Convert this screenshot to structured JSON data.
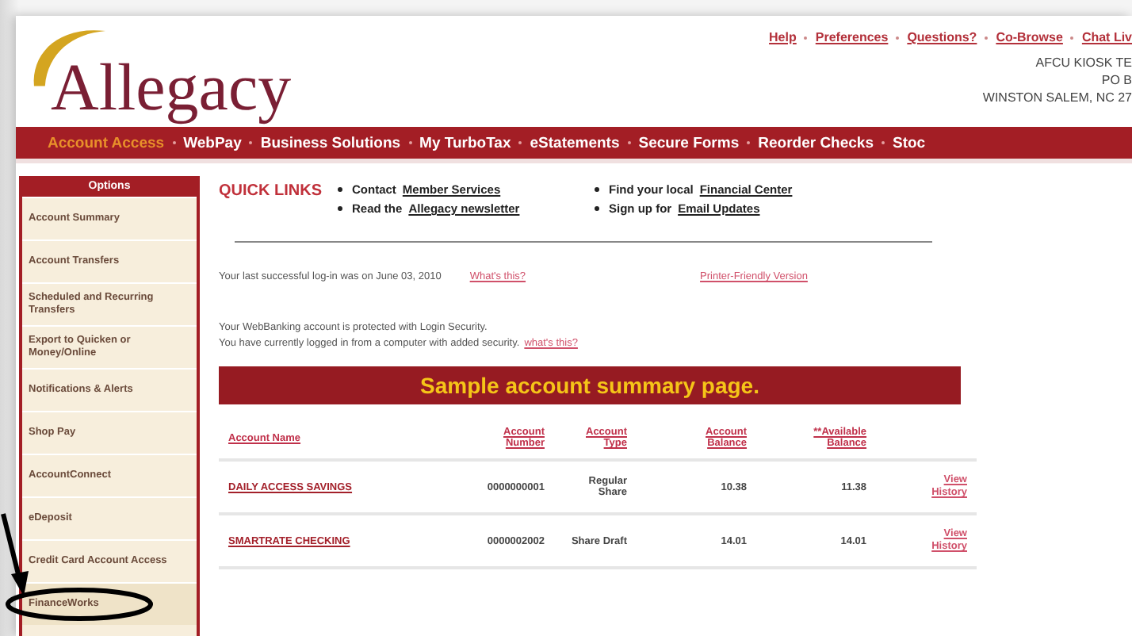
{
  "top_links": [
    "Help",
    "Preferences",
    "Questions?",
    "Co-Browse",
    "Chat Liv"
  ],
  "address": [
    "AFCU KIOSK TE",
    "PO B",
    "WINSTON SALEM, NC 27"
  ],
  "logo": "Allegacy",
  "nav": [
    {
      "label": "Account Access",
      "selected": true
    },
    {
      "label": "WebPay",
      "selected": false
    },
    {
      "label": "Business Solutions",
      "selected": false
    },
    {
      "label": "My TurboTax",
      "selected": false
    },
    {
      "label": "eStatements",
      "selected": false
    },
    {
      "label": "Secure Forms",
      "selected": false
    },
    {
      "label": "Reorder Checks",
      "selected": false
    },
    {
      "label": "Stoc",
      "selected": false
    }
  ],
  "sidebar": {
    "title": "Options",
    "items": [
      {
        "label": "Account Summary",
        "highlighted": false
      },
      {
        "label": "Account Transfers",
        "highlighted": false
      },
      {
        "label": "Scheduled and Recurring Transfers",
        "highlighted": false
      },
      {
        "label": "Export to Quicken or Money/Online",
        "highlighted": false
      },
      {
        "label": "Notifications & Alerts",
        "highlighted": false
      },
      {
        "label": "Shop Pay",
        "highlighted": false
      },
      {
        "label": "AccountConnect",
        "highlighted": false
      },
      {
        "label": "eDeposit",
        "highlighted": false
      },
      {
        "label": "Credit Card Account Access",
        "highlighted": false
      },
      {
        "label": "FinanceWorks",
        "highlighted": true
      }
    ]
  },
  "quick_links": {
    "title": "QUICK LINKS",
    "items": [
      {
        "text": "Contact",
        "link": "Member Services"
      },
      {
        "text": "Find your local",
        "link": "Financial Center"
      },
      {
        "text": "Read the",
        "link": "Allegacy newsletter"
      },
      {
        "text": "Sign up for",
        "link": "Email Updates"
      }
    ]
  },
  "last_login": {
    "text": "Your last successful log-in was on June 03, 2010",
    "link": "What's this?",
    "printer_link": "Printer-Friendly Version"
  },
  "security": {
    "lines": [
      "Your WebBanking account is protected with Login Security.",
      "You have currently logged in from a computer with added security."
    ],
    "link": "what's this?"
  },
  "banner": "Sample account summary page.",
  "table": {
    "columns": [
      "Account Name",
      "Account Number",
      "Account Type",
      "Account Balance",
      "**Available Balance"
    ],
    "rows": [
      {
        "name": "DAILY ACCESS SAVINGS",
        "number": "0000000001",
        "type": "Regular Share",
        "balance": "10.38",
        "available": "11.38",
        "action": "View History"
      },
      {
        "name": "SMARTRATE CHECKING",
        "number": "0000002002",
        "type": "Share Draft",
        "balance": "14.01",
        "available": "14.01",
        "action": "View History"
      }
    ]
  }
}
